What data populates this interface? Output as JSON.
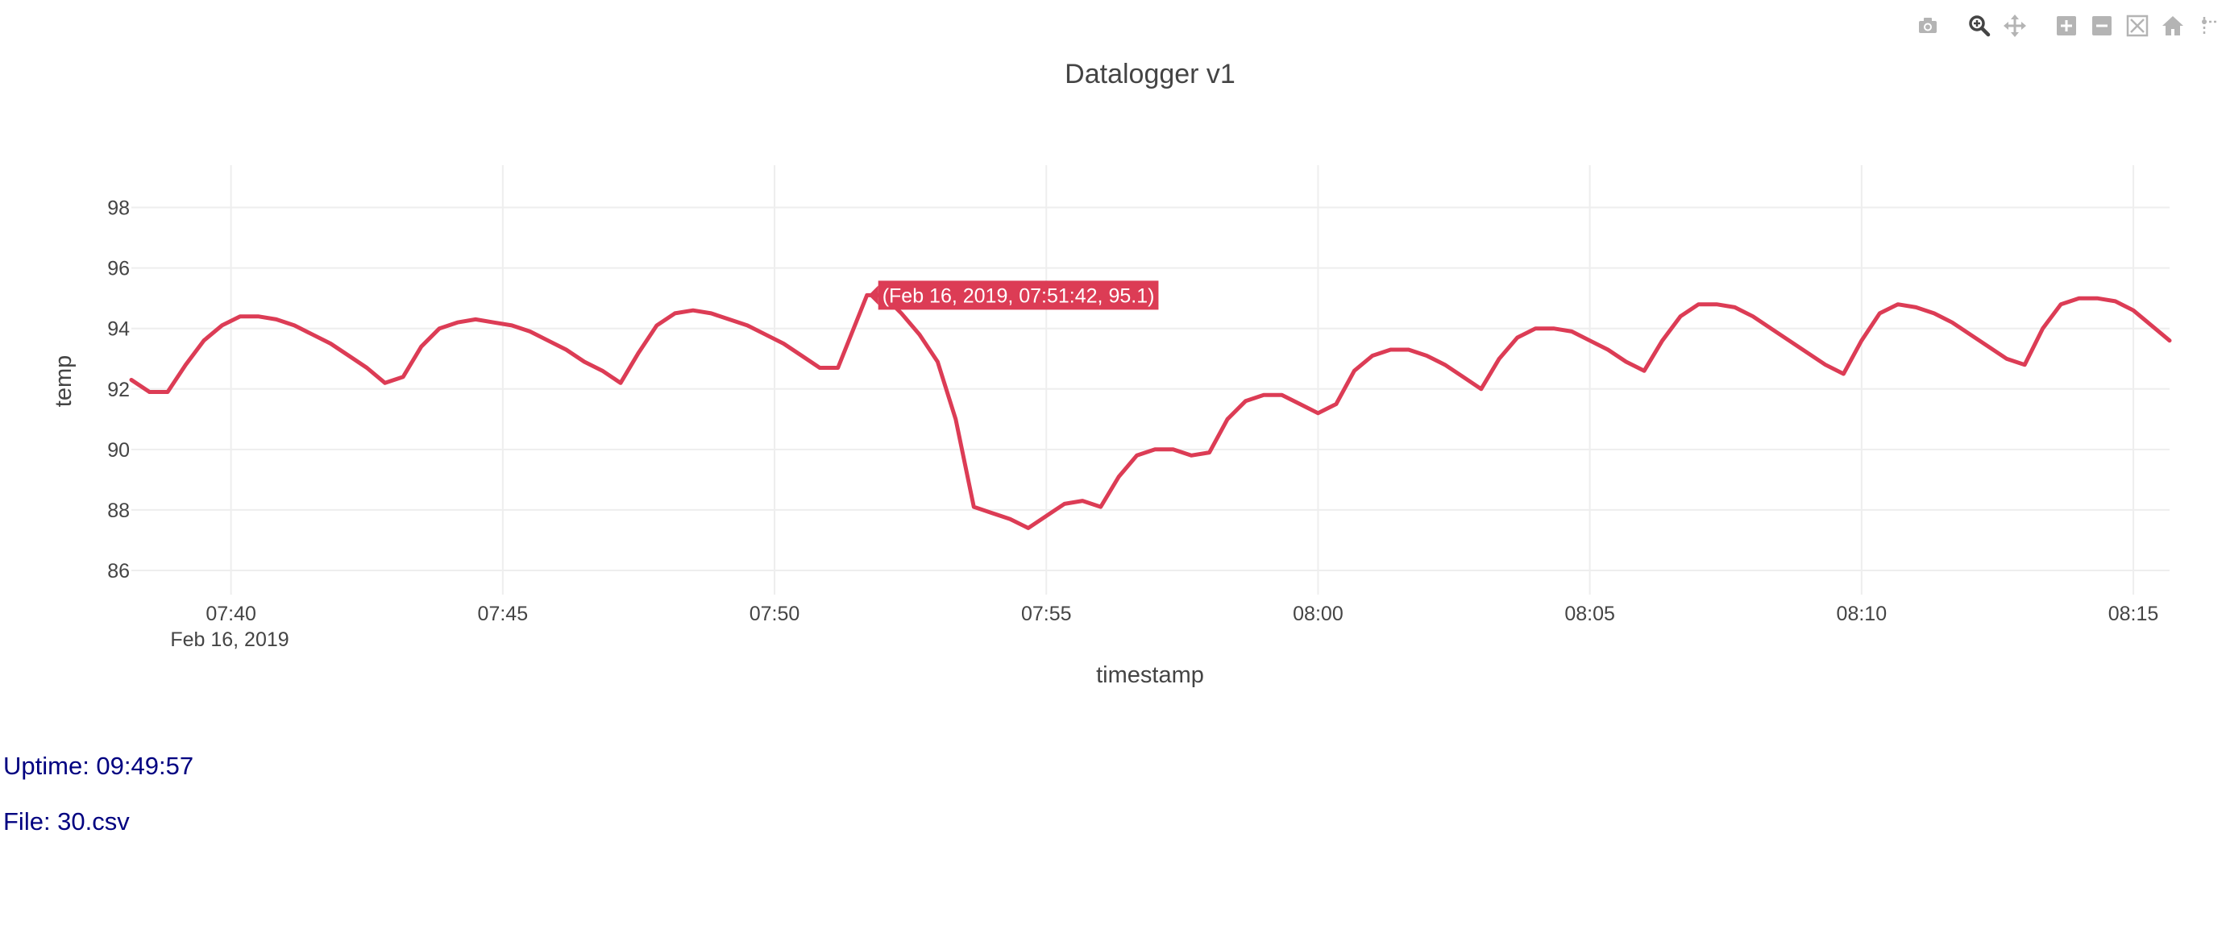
{
  "colors": {
    "line": "#dc3c55",
    "grid": "#eeeeee",
    "text": "#444444",
    "info_text": "#000080",
    "modebar_icon": "#b4b4b4",
    "modebar_active": "#444444"
  },
  "modebar": {
    "buttons": [
      {
        "icon": "camera-icon",
        "label": "Download plot as a png"
      },
      {
        "icon": "zoom-icon",
        "label": "Zoom",
        "active": true
      },
      {
        "icon": "pan-icon",
        "label": "Pan"
      },
      {
        "icon": "zoom-in-icon",
        "label": "Zoom in"
      },
      {
        "icon": "zoom-out-icon",
        "label": "Zoom out"
      },
      {
        "icon": "autoscale-icon",
        "label": "Autoscale"
      },
      {
        "icon": "home-icon",
        "label": "Reset axes"
      },
      {
        "icon": "spike-lines-icon",
        "label": "Toggle Spike Lines"
      }
    ]
  },
  "chart_data": {
    "type": "line",
    "title": "Datalogger v1",
    "xlabel": "timestamp",
    "ylabel": "temp",
    "x_date_label": "Feb 16, 2019",
    "xlim": [
      "2019-02-16 07:38:10",
      "2019-02-16 08:15:40"
    ],
    "ylim": [
      85.2,
      99.4
    ],
    "x_ticks": [
      "07:40",
      "07:45",
      "07:50",
      "07:55",
      "08:00",
      "08:05",
      "08:10",
      "08:15"
    ],
    "y_ticks": [
      86,
      88,
      90,
      92,
      94,
      96,
      98
    ],
    "grid": true,
    "series": [
      {
        "x": [
          "07:38:10",
          "07:38:30",
          "07:38:50",
          "07:39:10",
          "07:39:30",
          "07:39:50",
          "07:40:10",
          "07:40:30",
          "07:40:50",
          "07:41:10",
          "07:41:30",
          "07:41:50",
          "07:42:10",
          "07:42:30",
          "07:42:50",
          "07:43:10",
          "07:43:30",
          "07:43:50",
          "07:44:10",
          "07:44:30",
          "07:44:50",
          "07:45:10",
          "07:45:30",
          "07:45:50",
          "07:46:10",
          "07:46:30",
          "07:46:50",
          "07:47:10",
          "07:47:30",
          "07:47:50",
          "07:48:10",
          "07:48:30",
          "07:48:50",
          "07:49:10",
          "07:49:30",
          "07:49:50",
          "07:50:10",
          "07:50:30",
          "07:50:50",
          "07:51:10",
          "07:51:42",
          "07:52:00",
          "07:52:20",
          "07:52:40",
          "07:53:00",
          "07:53:20",
          "07:53:40",
          "07:54:00",
          "07:54:20",
          "07:54:40",
          "07:55:00",
          "07:55:20",
          "07:55:40",
          "07:56:00",
          "07:56:20",
          "07:56:40",
          "07:57:00",
          "07:57:20",
          "07:57:40",
          "07:58:00",
          "07:58:20",
          "07:58:40",
          "07:59:00",
          "07:59:20",
          "07:59:40",
          "08:00:00",
          "08:00:20",
          "08:00:40",
          "08:01:00",
          "08:01:20",
          "08:01:40",
          "08:02:00",
          "08:02:20",
          "08:02:40",
          "08:03:00",
          "08:03:20",
          "08:03:40",
          "08:04:00",
          "08:04:20",
          "08:04:40",
          "08:05:00",
          "08:05:20",
          "08:05:40",
          "08:06:00",
          "08:06:20",
          "08:06:40",
          "08:07:00",
          "08:07:20",
          "08:07:40",
          "08:08:00",
          "08:08:20",
          "08:08:40",
          "08:09:00",
          "08:09:20",
          "08:09:40",
          "08:10:00",
          "08:10:20",
          "08:10:40",
          "08:11:00",
          "08:11:20",
          "08:11:40",
          "08:12:00",
          "08:12:20",
          "08:12:40",
          "08:13:00",
          "08:13:20",
          "08:13:40",
          "08:14:00",
          "08:14:20",
          "08:14:40",
          "08:15:00",
          "08:15:20",
          "08:15:40"
        ],
        "y": [
          92.3,
          91.9,
          91.9,
          92.8,
          93.6,
          94.1,
          94.4,
          94.4,
          94.3,
          94.1,
          93.8,
          93.5,
          93.1,
          92.7,
          92.2,
          92.4,
          93.4,
          94.0,
          94.2,
          94.3,
          94.2,
          94.1,
          93.9,
          93.6,
          93.3,
          92.9,
          92.6,
          92.2,
          93.2,
          94.1,
          94.5,
          94.6,
          94.5,
          94.3,
          94.1,
          93.8,
          93.5,
          93.1,
          92.7,
          92.7,
          95.1,
          95.1,
          94.5,
          93.8,
          92.9,
          91.0,
          88.1,
          87.9,
          87.7,
          87.4,
          87.8,
          88.2,
          88.3,
          88.1,
          89.1,
          89.8,
          90.0,
          90.0,
          89.8,
          89.9,
          91.0,
          91.6,
          91.8,
          91.8,
          91.5,
          91.2,
          91.5,
          92.6,
          93.1,
          93.3,
          93.3,
          93.1,
          92.8,
          92.4,
          92.0,
          93.0,
          93.7,
          94.0,
          94.0,
          93.9,
          93.6,
          93.3,
          92.9,
          92.6,
          93.6,
          94.4,
          94.8,
          94.8,
          94.7,
          94.4,
          94.0,
          93.6,
          93.2,
          92.8,
          92.5,
          93.6,
          94.5,
          94.8,
          94.7,
          94.5,
          94.2,
          93.8,
          93.4,
          93.0,
          92.8,
          94.0,
          94.8,
          95.0,
          95.0,
          94.9,
          94.6,
          94.1,
          93.6
        ]
      }
    ],
    "hover_label": "(Feb 16, 2019, 07:51:42, 95.1)"
  },
  "info": {
    "uptime": "Uptime: 09:49:57",
    "file": "File: 30.csv"
  }
}
